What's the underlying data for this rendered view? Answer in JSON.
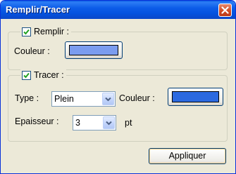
{
  "window": {
    "title": "Remplir/Tracer",
    "close_icon": "close-x-icon"
  },
  "fill": {
    "checkbox_label": "Remplir :",
    "checked": true,
    "color_label": "Couleur :",
    "color": "#7b9cef"
  },
  "stroke": {
    "checkbox_label": "Tracer :",
    "checked": true,
    "type_label": "Type :",
    "type_value": "Plein",
    "color_label": "Couleur :",
    "color": "#2b69e0",
    "thickness_label": "Epaisseur :",
    "thickness_value": "3",
    "thickness_unit": "pt"
  },
  "buttons": {
    "apply_label": "Appliquer"
  },
  "colors": {
    "titlebar": "#0a5be3",
    "dialog_bg": "#ece9d8",
    "check": "#21a121"
  }
}
